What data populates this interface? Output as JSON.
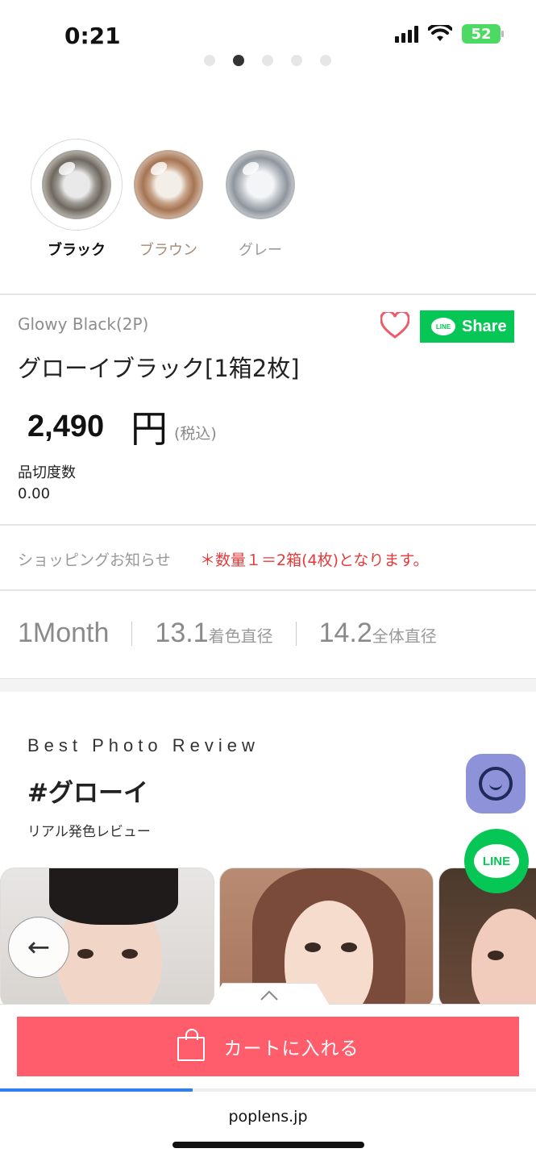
{
  "status_bar": {
    "time": "0:21",
    "battery": "52"
  },
  "carousel": {
    "dots": 5,
    "active_dot": 1
  },
  "colors": [
    {
      "label": "ブラック",
      "selected": true
    },
    {
      "label": "ブラウン",
      "selected": false
    },
    {
      "label": "グレー",
      "selected": false
    }
  ],
  "product": {
    "english_name": "Glowy Black(2P)",
    "japanese_name": "グローイブラック[1箱2枚]",
    "price": "2,490",
    "currency": "円",
    "tax_note": "(税込)",
    "stock_label": "品切度数",
    "stock_value": "0.00",
    "share_label": "Share",
    "share_icon_text": "LINE"
  },
  "notice": {
    "label": "ショッピングお知らせ",
    "text": "＊数量１＝2箱(4枚)となります。"
  },
  "specs": {
    "period": "1Month",
    "coloring_diameter": "13.1",
    "coloring_label": "着色直径",
    "total_diameter": "14.2",
    "total_label": "全体直径"
  },
  "review": {
    "kicker": "Best Photo Review",
    "tag": "#グローイ",
    "subtitle": "リアル発色レビュー"
  },
  "floating": {
    "line_label": "LINE"
  },
  "cart": {
    "button_label": "カートに入れる",
    "tab_icon": "chevron-up-icon"
  },
  "browser": {
    "url": "poplens.jp",
    "load_progress": 0.36
  },
  "theme": {
    "accent": "#ff5c6c",
    "line_green": "#06c755",
    "notice_red": "#e53a3a"
  }
}
